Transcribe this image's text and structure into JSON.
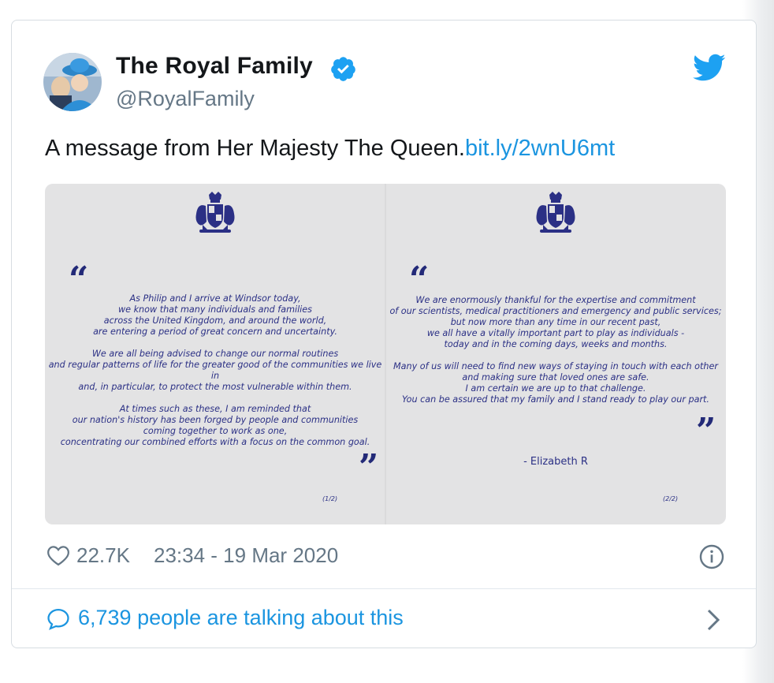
{
  "tweet": {
    "display_name": "The Royal Family",
    "handle": "@RoyalFamily",
    "text": "A message from Her Majesty The Queen.",
    "link": "bit.ly/2wnU6mt",
    "likes": "22.7K",
    "timestamp": "23:34 - 19 Mar 2020",
    "talking": "6,739 people are talking about this"
  },
  "letter": {
    "open_quote": "“",
    "close_quote": "”",
    "page1": {
      "paragraph1": [
        "As Philip and I arrive at Windsor today,",
        "we know that many individuals and families",
        "across the United Kingdom, and around the world,",
        "are entering a period of great concern and uncertainty."
      ],
      "paragraph2": [
        "We are all being advised to change our normal routines",
        "and regular patterns of life for the greater good of the communities we live in",
        "and, in particular, to protect the most vulnerable within them."
      ],
      "paragraph3": [
        "At times such as these, I am reminded that",
        "our nation's history has been forged by people and communities",
        "coming together to work as one,",
        "concentrating our combined efforts with a focus on the common goal."
      ],
      "page_number": "(1/2)"
    },
    "page2": {
      "paragraph1": [
        "We are enormously thankful for the expertise and commitment",
        "of our scientists, medical practitioners and emergency and public services;",
        "but now more than any time in our recent past,",
        "we all have a vitally important part to play as individuals -",
        "today and in the coming days, weeks and months."
      ],
      "paragraph2": [
        "Many of us will need to find new ways of staying in touch with each other",
        "and making sure that loved ones are safe.",
        "I am certain we are up to that challenge.",
        "You can be assured that my family and I stand ready to play our part."
      ],
      "signature": "- Elizabeth R",
      "page_number": "(2/2)"
    }
  },
  "colors": {
    "link_blue": "#1b95e0",
    "twitter_blue": "#1da1f2",
    "verified_blue": "#1da1f2",
    "letter_navy": "#2b3085",
    "muted_gray": "#657786"
  },
  "icons": {
    "verified": "verified-badge-icon",
    "brand": "twitter-bird-icon",
    "like": "heart-icon",
    "info": "info-icon",
    "comment": "comment-icon",
    "chevron": "chevron-right-icon",
    "crest": "royal-coat-of-arms-icon"
  }
}
